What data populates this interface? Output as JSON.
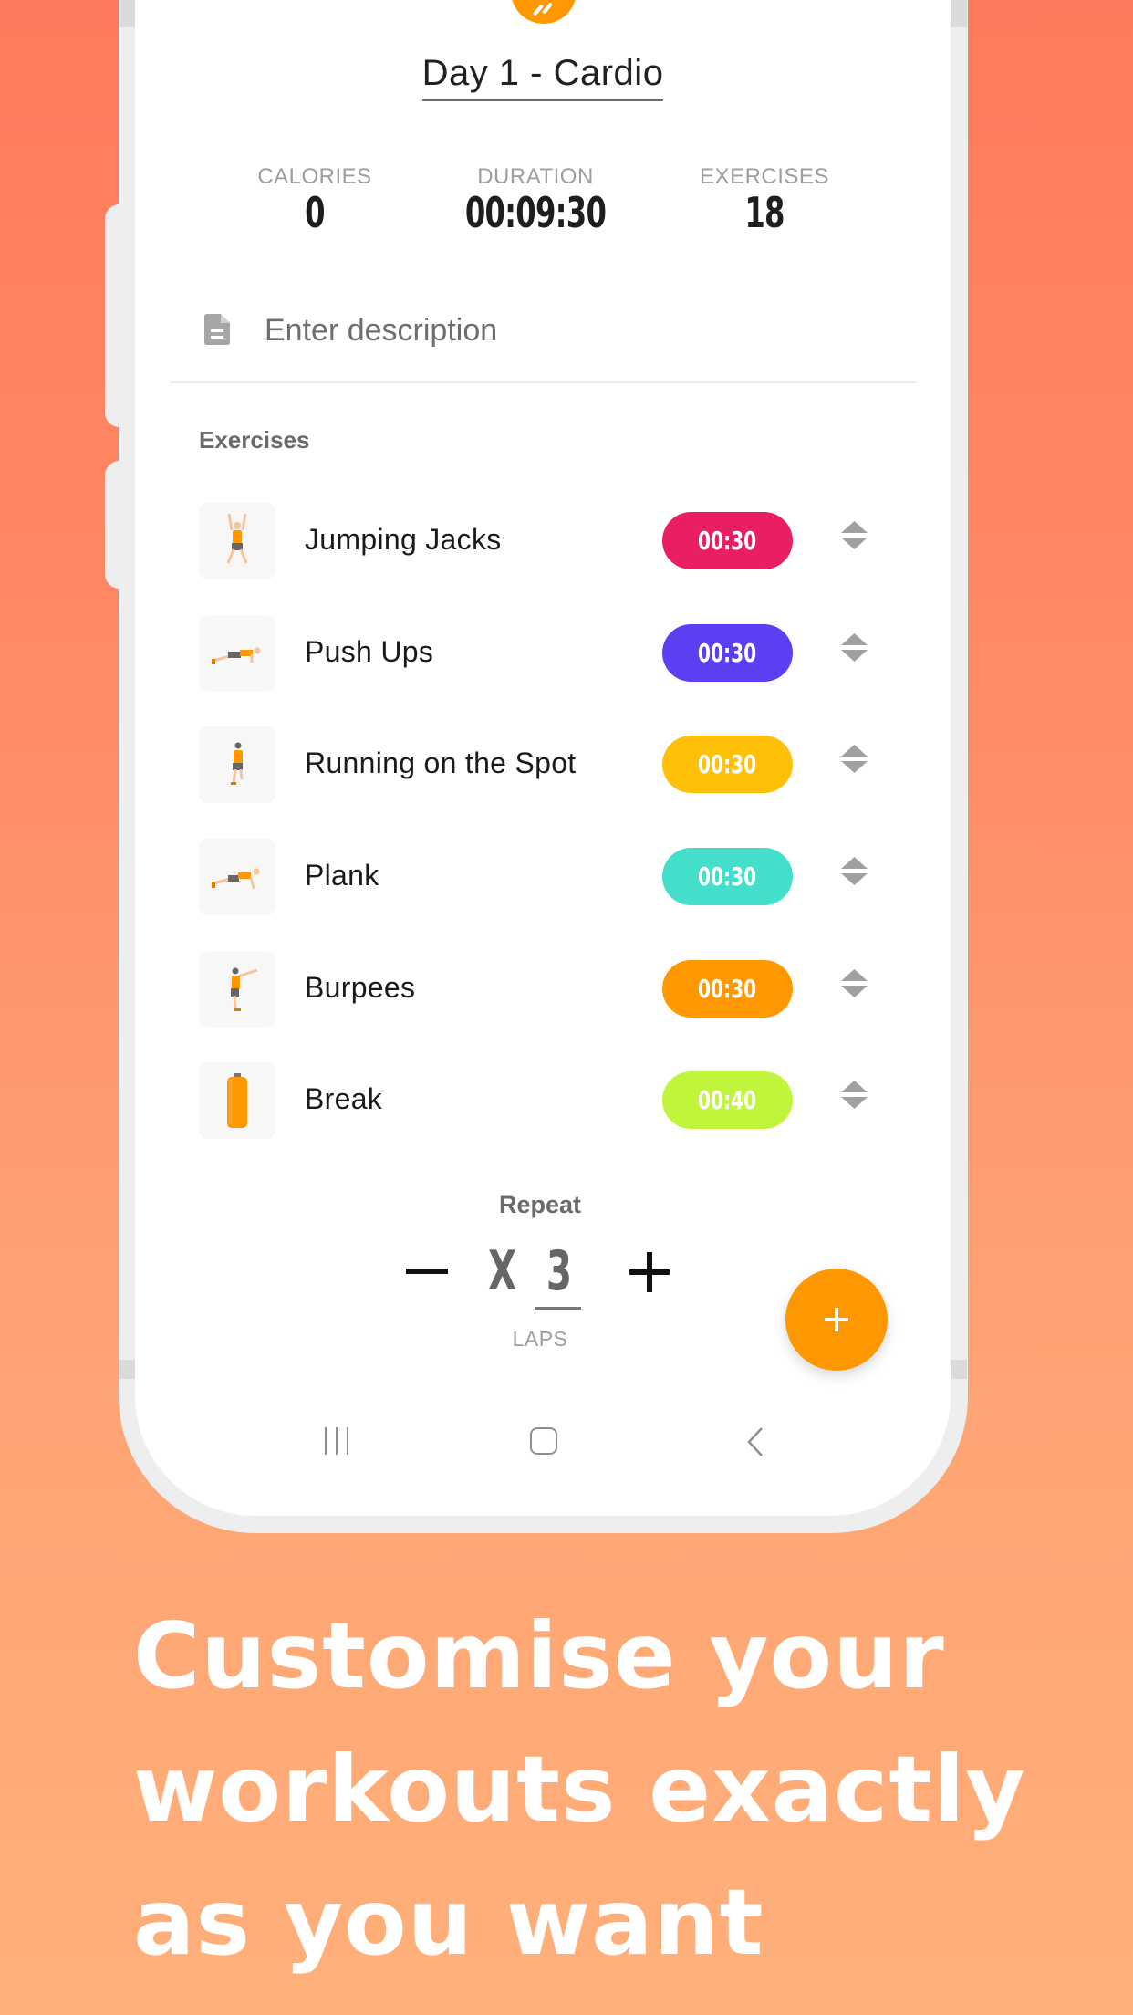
{
  "workout": {
    "title": "Day 1 - Cardio",
    "stats": [
      {
        "label": "CALORIES",
        "value": "0"
      },
      {
        "label": "DURATION",
        "value": "00:09:30"
      },
      {
        "label": "EXERCISES",
        "value": "18"
      }
    ],
    "description": {
      "placeholder": "Enter description",
      "value": "",
      "icon": "document-icon"
    }
  },
  "exercises_section": {
    "label": "Exercises",
    "items": [
      {
        "name": "Jumping Jacks",
        "duration": "00:30",
        "color": "#E91E63",
        "thumbnail": "jumping-jacks-figure"
      },
      {
        "name": "Push Ups",
        "duration": "00:30",
        "color": "#5B3FF2",
        "thumbnail": "push-ups-figure"
      },
      {
        "name": "Running on the Spot",
        "duration": "00:30",
        "color": "#FFC107",
        "thumbnail": "running-figure"
      },
      {
        "name": "Plank",
        "duration": "00:30",
        "color": "#43DFCA",
        "thumbnail": "plank-figure"
      },
      {
        "name": "Burpees",
        "duration": "00:30",
        "color": "#FF9800",
        "thumbnail": "burpees-figure"
      },
      {
        "name": "Break",
        "duration": "00:40",
        "color": "#C1F53C",
        "thumbnail": "water-bottle"
      }
    ]
  },
  "repeat": {
    "label": "Repeat",
    "prefix": "X",
    "value": "3",
    "unit": "LAPS",
    "decrement_icon": "minus-icon",
    "increment_icon": "plus-icon"
  },
  "fab": {
    "icon": "plus-icon",
    "color": "#FF9800"
  },
  "nav_bar": {
    "recents": "recents-icon",
    "home": "home-icon",
    "back": "back-icon"
  },
  "colors": {
    "accent": "#FF9800",
    "bg_top": "#FF7A5C",
    "bg_bottom": "#FFB07A"
  },
  "tagline": {
    "lines": [
      "Customise your",
      "workouts exactly",
      "as you want"
    ]
  }
}
